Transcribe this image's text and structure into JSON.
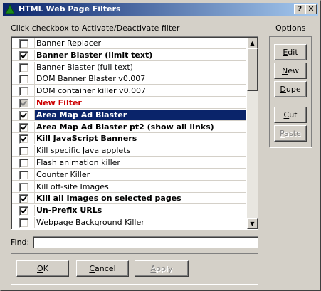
{
  "window": {
    "title": "HTML Web Page Filters",
    "help_label": "?",
    "close_label": "✕"
  },
  "instructions": "Click checkbox to Activate/Deactivate filter",
  "options_label": "Options",
  "filters": [
    {
      "label": "Banner Replacer",
      "checked": false,
      "style": "normal"
    },
    {
      "label": "Banner Blaster (limit text)",
      "checked": true,
      "style": "bold"
    },
    {
      "label": "Banner Blaster (full text)",
      "checked": false,
      "style": "normal"
    },
    {
      "label": "DOM Banner Blaster v0.007",
      "checked": false,
      "style": "normal"
    },
    {
      "label": "DOM container killer v0.007",
      "checked": false,
      "style": "normal"
    },
    {
      "label": "New Filter",
      "checked": true,
      "style": "red",
      "grayed": true
    },
    {
      "label": "Area Map Ad Blaster",
      "checked": true,
      "style": "selected"
    },
    {
      "label": "Area Map Ad Blaster pt2 (show all links)",
      "checked": true,
      "style": "bold"
    },
    {
      "label": "Kill JavaScript Banners",
      "checked": true,
      "style": "bold"
    },
    {
      "label": "Kill specific Java applets",
      "checked": false,
      "style": "normal"
    },
    {
      "label": "Flash animation killer",
      "checked": false,
      "style": "normal"
    },
    {
      "label": "Counter Killer",
      "checked": false,
      "style": "normal"
    },
    {
      "label": "Kill off-site Images",
      "checked": false,
      "style": "normal"
    },
    {
      "label": "Kill all Images on selected pages",
      "checked": true,
      "style": "bold"
    },
    {
      "label": "Un-Prefix URLs",
      "checked": true,
      "style": "bold"
    },
    {
      "label": "Webpage Background Killer",
      "checked": false,
      "style": "normal"
    }
  ],
  "option_buttons": {
    "edit": "Edit",
    "new": "New",
    "dupe": "Dupe",
    "cut": "Cut",
    "paste": "Paste"
  },
  "find": {
    "label": "Find:",
    "value": ""
  },
  "footer_buttons": {
    "ok": "OK",
    "cancel": "Cancel",
    "apply": "Apply"
  },
  "colors": {
    "selection": "#0a246a",
    "new_filter_text": "#cc0000",
    "face": "#d4d0c8"
  }
}
